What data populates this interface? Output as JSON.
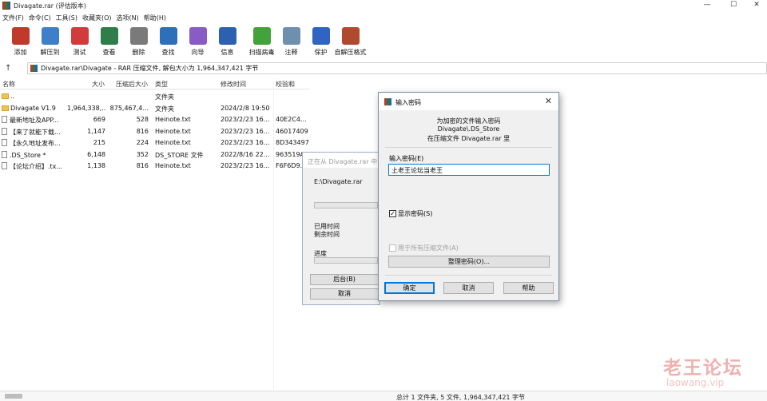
{
  "window": {
    "title": "Divagate.rar (评估版本)",
    "controls": [
      "—",
      "☐",
      "✕"
    ]
  },
  "menu": [
    "文件(F)",
    "命令(C)",
    "工具(S)",
    "收藏夹(O)",
    "选项(N)",
    "帮助(H)"
  ],
  "toolbar": [
    {
      "label": "添加",
      "icon": "add-archive-icon",
      "color": "#c0392b"
    },
    {
      "label": "解压到",
      "icon": "extract-folder-icon",
      "color": "#3f7fc9"
    },
    {
      "label": "测试",
      "icon": "test-checklist-icon",
      "color": "#d23b3b"
    },
    {
      "label": "查看",
      "icon": "view-book-icon",
      "color": "#2f7d4a"
    },
    {
      "label": "删除",
      "icon": "trash-icon",
      "color": "#7a7a7a"
    },
    {
      "label": "查找",
      "icon": "magnifier-icon",
      "color": "#2d6fb8"
    },
    {
      "label": "向导",
      "icon": "wizard-wand-icon",
      "color": "#8a5bc4"
    },
    {
      "label": "信息",
      "icon": "info-icon",
      "color": "#2a62b0"
    },
    {
      "label": "扫描病毒",
      "icon": "virus-scan-icon",
      "color": "#44a23a"
    },
    {
      "label": "注释",
      "icon": "comment-icon",
      "color": "#6f8fb0"
    },
    {
      "label": "保护",
      "icon": "shield-icon",
      "color": "#2f64c2"
    },
    {
      "label": "自解压格式",
      "icon": "sfx-icon",
      "color": "#b04a2e"
    }
  ],
  "address": {
    "up": "↑",
    "path": "Divagate.rar\\Divagate - RAR 压缩文件, 解包大小为 1,964,347,421 字节"
  },
  "columns": [
    "名称",
    "大小",
    "压缩后大小",
    "类型",
    "修改时间",
    "校验和"
  ],
  "rows": [
    {
      "name": "..",
      "size": "",
      "packed": "",
      "type": "文件夹",
      "modified": "",
      "crc": "",
      "kind": "folder"
    },
    {
      "name": "Divagate V1.9",
      "size": "1,964,338,...",
      "packed": "875,467,4...",
      "type": "文件夹",
      "modified": "2024/2/8 19:50",
      "crc": "",
      "kind": "folder"
    },
    {
      "name": "最新地址及APP...",
      "size": "669",
      "packed": "528",
      "type": "Heinote.txt",
      "modified": "2023/2/23 16...",
      "crc": "40E2C4...",
      "kind": "file"
    },
    {
      "name": "【来了就能下载...",
      "size": "1,147",
      "packed": "816",
      "type": "Heinote.txt",
      "modified": "2023/2/23 16...",
      "crc": "46017409",
      "kind": "file"
    },
    {
      "name": "【永久地址发布...",
      "size": "215",
      "packed": "224",
      "type": "Heinote.txt",
      "modified": "2023/2/23 16...",
      "crc": "8D343497",
      "kind": "file"
    },
    {
      "name": ".DS_Store *",
      "size": "6,148",
      "packed": "352",
      "type": "DS_STORE 文件",
      "modified": "2022/8/16 22...",
      "crc": "963519A...",
      "kind": "file"
    },
    {
      "name": "【论坛介绍】.tx...",
      "size": "1,138",
      "packed": "816",
      "type": "Heinote.txt",
      "modified": "2023/2/23 16...",
      "crc": "F6F6D9...",
      "kind": "file"
    }
  ],
  "progress_dialog": {
    "title": "正在从 Divagate.rar 中",
    "archive": "E:\\Divagate.rar",
    "elapsed_label": "已用时间",
    "remaining_label": "剩余时间",
    "progress_label": "进度",
    "background_button": "后台(B)",
    "cancel_button": "取消"
  },
  "password_dialog": {
    "title": "输入密码",
    "close": "✕",
    "info_line1": "为加密的文件输入密码",
    "info_line2": "Divagate\\.DS_Store",
    "info_line3": "在压缩文件 Divagate.rar 里",
    "field_label": "输入密码(E)",
    "password_value": "上老王论坛当老王",
    "dropdown": "⌵",
    "show_password_label": "显示密码(S)",
    "show_password_checked": "✓",
    "use_for_all_label": "用于所有压缩文件(A)",
    "organize_button": "整理密码(O)...",
    "ok_button": "确定",
    "cancel_button": "取消",
    "help_button": "帮助"
  },
  "status": {
    "text": "总计 1 文件夹, 5 文件, 1,964,347,421 字节"
  },
  "watermark": {
    "line1": "老王论坛",
    "line2": "laowang.vip"
  }
}
